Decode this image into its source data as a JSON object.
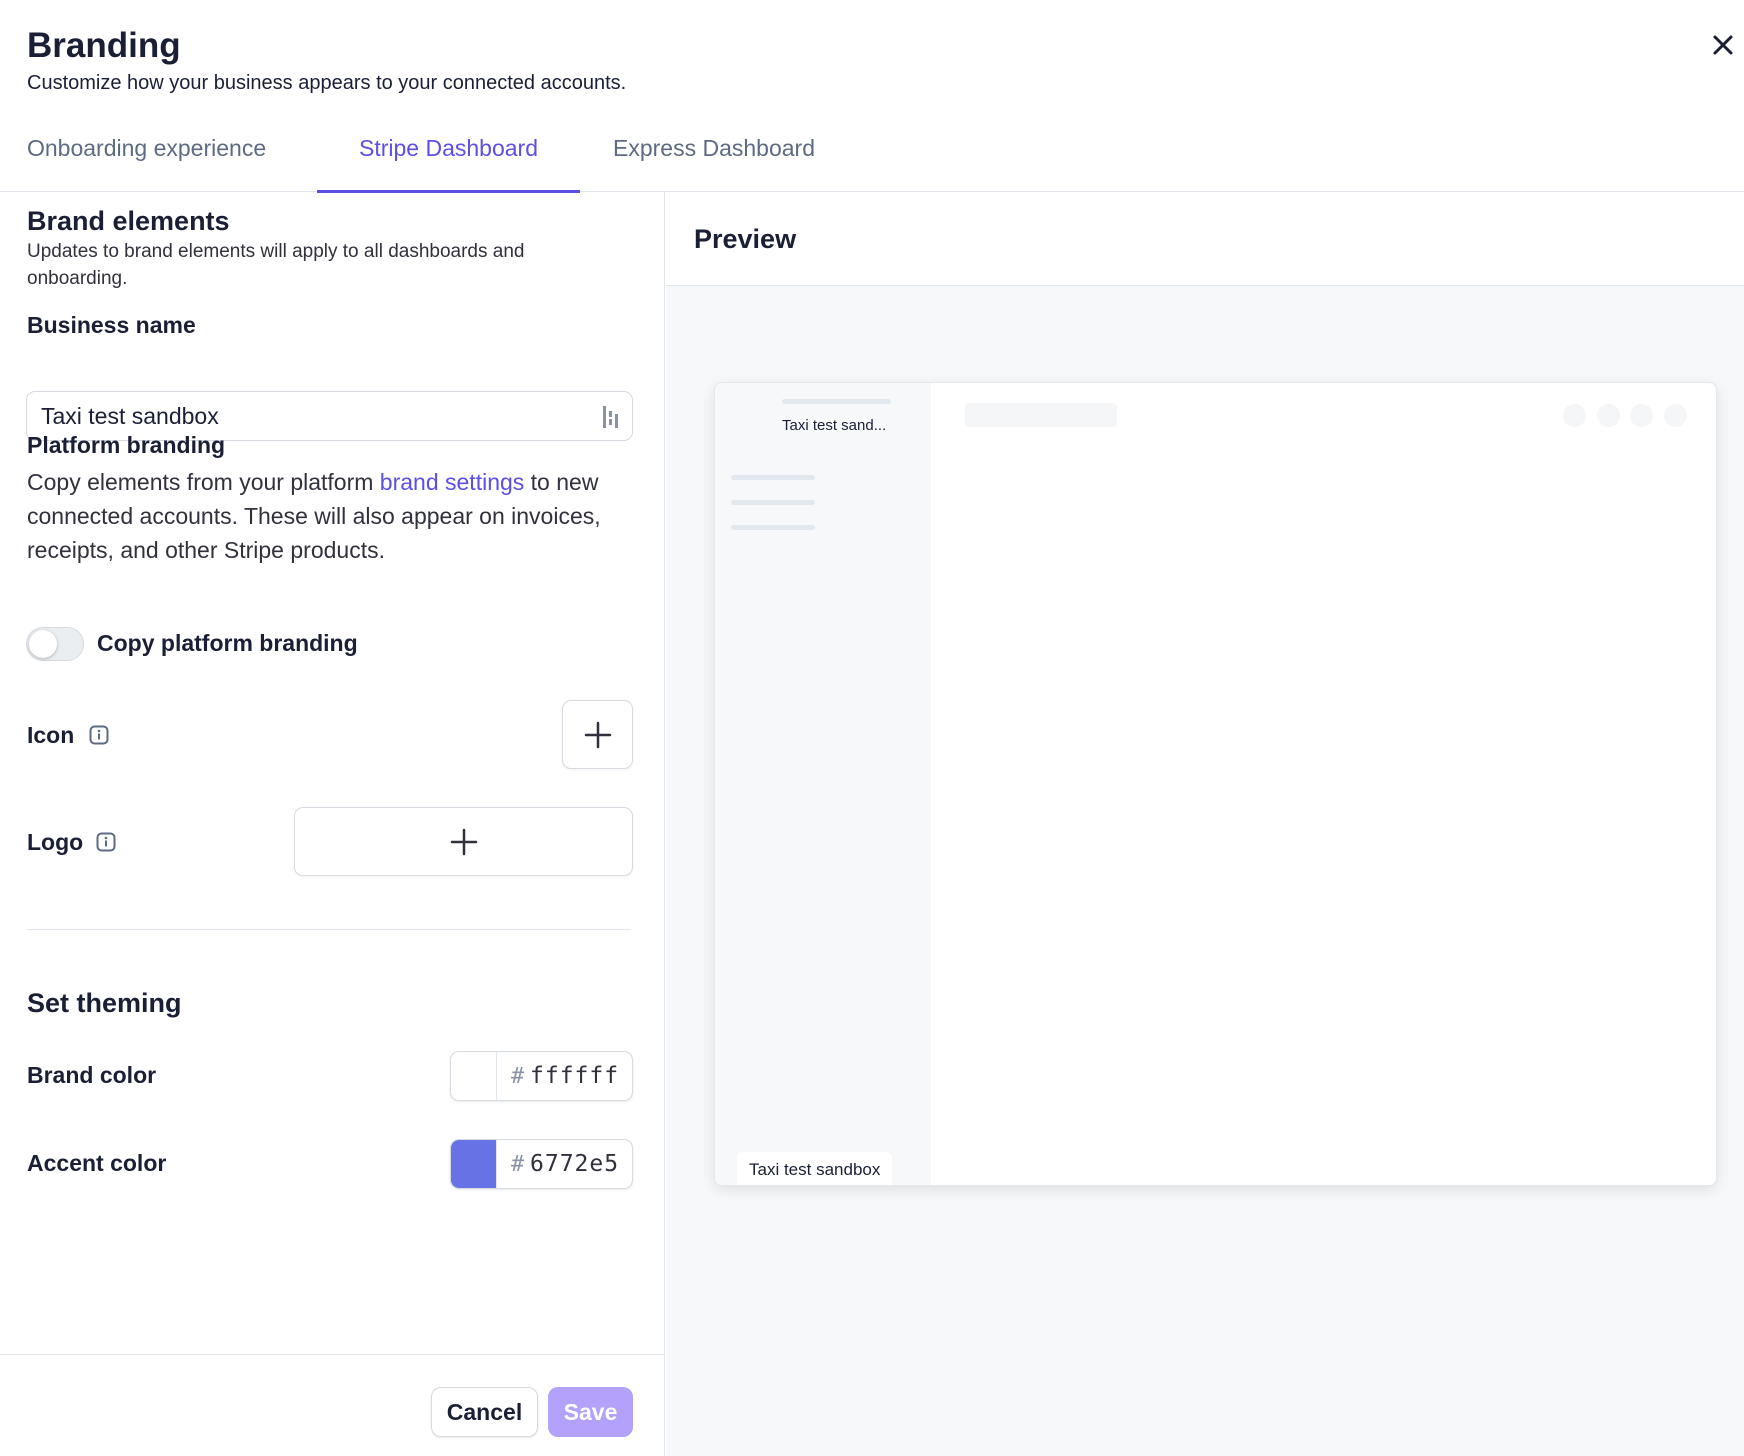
{
  "header": {
    "title": "Branding",
    "subtitle": "Customize how your business appears to your connected accounts."
  },
  "tabs": [
    {
      "label": "Onboarding experience",
      "active": false
    },
    {
      "label": "Stripe Dashboard",
      "active": true
    },
    {
      "label": "Express Dashboard",
      "active": false
    }
  ],
  "brand_elements": {
    "title": "Brand elements",
    "description": "Updates to brand elements will apply to all dashboards and onboarding.",
    "business_name_label": "Business name",
    "business_name_value": "Taxi test sandbox"
  },
  "platform_branding": {
    "title": "Platform branding",
    "text_before": "Copy elements from your platform ",
    "link_text": "brand settings",
    "text_after": " to new connected accounts. These will also appear on invoices, receipts, and other Stripe products.",
    "toggle_label": "Copy platform branding",
    "toggle_on": false
  },
  "uploads": {
    "icon_label": "Icon",
    "logo_label": "Logo"
  },
  "theming": {
    "title": "Set theming",
    "brand_color_label": "Brand color",
    "brand_color_hash": "#",
    "brand_color_value": "ffffff",
    "brand_color": "#ffffff",
    "accent_color_label": "Accent color",
    "accent_color_hash": "#",
    "accent_color_value": "6772e5",
    "accent_color": "#6772e5"
  },
  "footer": {
    "cancel_label": "Cancel",
    "save_label": "Save"
  },
  "preview": {
    "title": "Preview",
    "sidebar_name": "Taxi test sand...",
    "account_chip": "Taxi test sandbox"
  },
  "colors": {
    "primary": "#5b4fe6",
    "save_disabled": "#b3a1fb",
    "text": "#1a1f36",
    "border": "#e3e8ee"
  }
}
